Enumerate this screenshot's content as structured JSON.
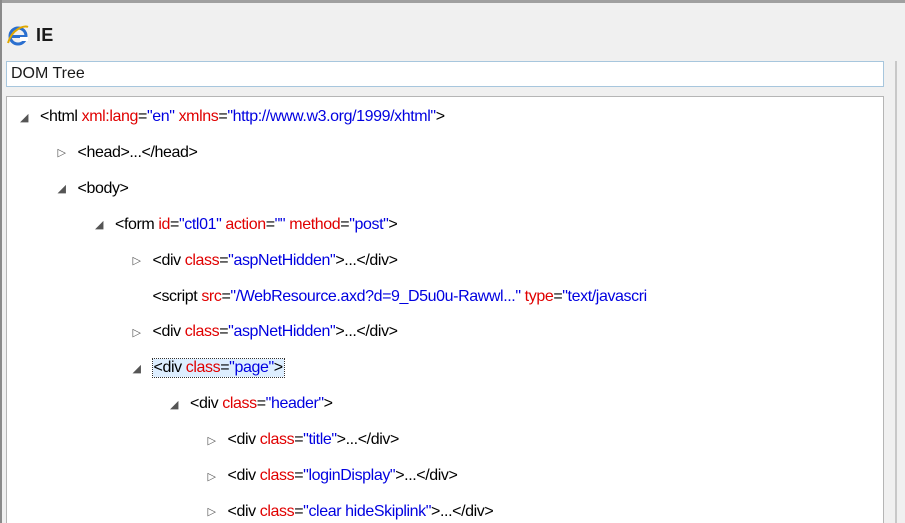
{
  "window": {
    "title": "IE",
    "icon": "ie-icon"
  },
  "section": {
    "label": "DOM Tree"
  },
  "tree": [
    {
      "indent": 0,
      "toggle": "expanded",
      "parts": [
        {
          "t": "tag",
          "v": "<html "
        },
        {
          "t": "attr",
          "v": "xml:lang"
        },
        {
          "t": "eq",
          "v": "="
        },
        {
          "t": "val",
          "v": "\"en\""
        },
        {
          "t": "tag",
          "v": " "
        },
        {
          "t": "attr",
          "v": "xmlns"
        },
        {
          "t": "eq",
          "v": "="
        },
        {
          "t": "val",
          "v": "\"http://www.w3.org/1999/xhtml\""
        },
        {
          "t": "tag",
          "v": ">"
        }
      ]
    },
    {
      "indent": 1,
      "toggle": "collapsed",
      "parts": [
        {
          "t": "tag",
          "v": "<head>...</head>"
        }
      ]
    },
    {
      "indent": 1,
      "toggle": "expanded",
      "parts": [
        {
          "t": "tag",
          "v": "<body>"
        }
      ]
    },
    {
      "indent": 2,
      "toggle": "expanded",
      "parts": [
        {
          "t": "tag",
          "v": "<form "
        },
        {
          "t": "attr",
          "v": "id"
        },
        {
          "t": "eq",
          "v": "="
        },
        {
          "t": "val",
          "v": "\"ctl01\""
        },
        {
          "t": "tag",
          "v": " "
        },
        {
          "t": "attr",
          "v": "action"
        },
        {
          "t": "eq",
          "v": "="
        },
        {
          "t": "val",
          "v": "\"\""
        },
        {
          "t": "tag",
          "v": " "
        },
        {
          "t": "attr",
          "v": "method"
        },
        {
          "t": "eq",
          "v": "="
        },
        {
          "t": "val",
          "v": "\"post\""
        },
        {
          "t": "tag",
          "v": ">"
        }
      ]
    },
    {
      "indent": 3,
      "toggle": "collapsed",
      "parts": [
        {
          "t": "tag",
          "v": "<div "
        },
        {
          "t": "attr",
          "v": "class"
        },
        {
          "t": "eq",
          "v": "="
        },
        {
          "t": "val",
          "v": "\"aspNetHidden\""
        },
        {
          "t": "tag",
          "v": ">...</div>"
        }
      ]
    },
    {
      "indent": 3,
      "toggle": "none",
      "parts": [
        {
          "t": "tag",
          "v": "<script "
        },
        {
          "t": "attr",
          "v": "src"
        },
        {
          "t": "eq",
          "v": "="
        },
        {
          "t": "val",
          "v": "\"/WebResource.axd?d=9_D5u0u-Rawwl...\""
        },
        {
          "t": "tag",
          "v": " "
        },
        {
          "t": "attr",
          "v": "type"
        },
        {
          "t": "eq",
          "v": "="
        },
        {
          "t": "val",
          "v": "\"text/javascri"
        }
      ]
    },
    {
      "indent": 3,
      "toggle": "collapsed",
      "parts": [
        {
          "t": "tag",
          "v": "<div "
        },
        {
          "t": "attr",
          "v": "class"
        },
        {
          "t": "eq",
          "v": "="
        },
        {
          "t": "val",
          "v": "\"aspNetHidden\""
        },
        {
          "t": "tag",
          "v": ">...</div>"
        }
      ]
    },
    {
      "indent": 3,
      "toggle": "expanded",
      "selected": true,
      "parts": [
        {
          "t": "tag",
          "v": "<div "
        },
        {
          "t": "attr",
          "v": "class"
        },
        {
          "t": "eq",
          "v": "="
        },
        {
          "t": "val",
          "v": "\"page\""
        },
        {
          "t": "tag",
          "v": ">"
        }
      ]
    },
    {
      "indent": 4,
      "toggle": "expanded",
      "parts": [
        {
          "t": "tag",
          "v": "<div "
        },
        {
          "t": "attr",
          "v": "class"
        },
        {
          "t": "eq",
          "v": "="
        },
        {
          "t": "val",
          "v": "\"header\""
        },
        {
          "t": "tag",
          "v": ">"
        }
      ]
    },
    {
      "indent": 5,
      "toggle": "collapsed",
      "parts": [
        {
          "t": "tag",
          "v": "<div "
        },
        {
          "t": "attr",
          "v": "class"
        },
        {
          "t": "eq",
          "v": "="
        },
        {
          "t": "val",
          "v": "\"title\""
        },
        {
          "t": "tag",
          "v": ">...</div>"
        }
      ]
    },
    {
      "indent": 5,
      "toggle": "collapsed",
      "parts": [
        {
          "t": "tag",
          "v": "<div "
        },
        {
          "t": "attr",
          "v": "class"
        },
        {
          "t": "eq",
          "v": "="
        },
        {
          "t": "val",
          "v": "\"loginDisplay\""
        },
        {
          "t": "tag",
          "v": ">...</div>"
        }
      ]
    },
    {
      "indent": 5,
      "toggle": "collapsed",
      "parts": [
        {
          "t": "tag",
          "v": "<div "
        },
        {
          "t": "attr",
          "v": "class"
        },
        {
          "t": "eq",
          "v": "="
        },
        {
          "t": "val",
          "v": "\"clear hideSkiplink\""
        },
        {
          "t": "tag",
          "v": ">...</div>"
        }
      ]
    }
  ],
  "colors": {
    "tag": "#000000",
    "attr": "#e00000",
    "value": "#0000e0",
    "selection_bg": "#ddeeff"
  }
}
